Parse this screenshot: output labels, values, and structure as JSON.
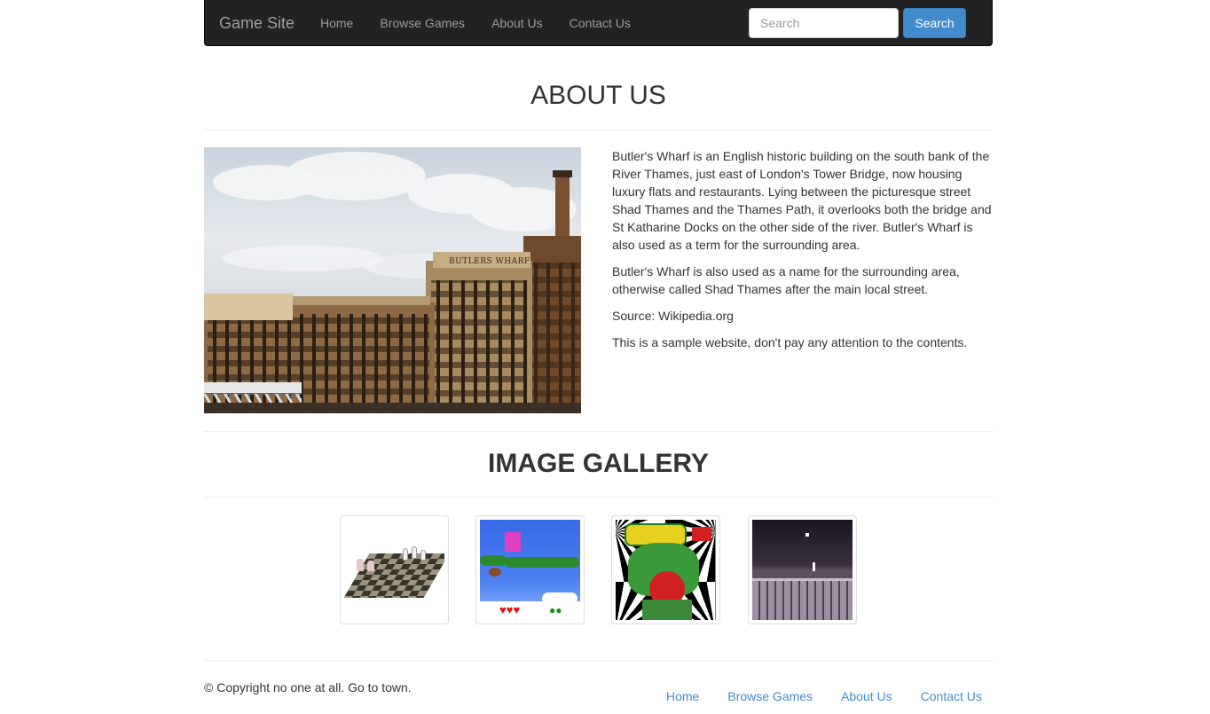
{
  "navbar": {
    "brand": "Game Site",
    "links": [
      "Home",
      "Browse Games",
      "About Us",
      "Contact Us"
    ],
    "search_placeholder": "Search",
    "search_button": "Search",
    "background_color": "#222222",
    "link_color": "#9d9d9d"
  },
  "about": {
    "title": "ABOUT US",
    "image_sign": "BUTLERS WHARF",
    "paragraphs": [
      "Butler's Wharf is an English historic building on the south bank of the River Thames, just east of London's Tower Bridge, now housing luxury flats and restaurants. Lying between the picturesque street Shad Thames and the Thames Path, it overlooks both the bridge and St Katharine Docks on the other side of the river. Butler's Wharf is also used as a term for the surrounding area.",
      "Butler's Wharf is also used as a name for the surrounding area, otherwise called Shad Thames after the main local street.",
      "Source: Wikipedia.org",
      "This is a sample website, don't pay any attention to the contents."
    ]
  },
  "gallery": {
    "title": "IMAGE GALLERY",
    "thumbnails": [
      "chessboard-thumbnail",
      "platformer-thumbnail",
      "comic-cover-thumbnail",
      "night-city-thumbnail"
    ]
  },
  "footer": {
    "copyright": "© Copyright no one at all. Go to town.",
    "links": [
      "Home",
      "Browse Games",
      "About Us",
      "Contact Us"
    ],
    "link_color": "#428bca"
  },
  "colors": {
    "primary_button": "#428bca",
    "text": "#333333"
  }
}
